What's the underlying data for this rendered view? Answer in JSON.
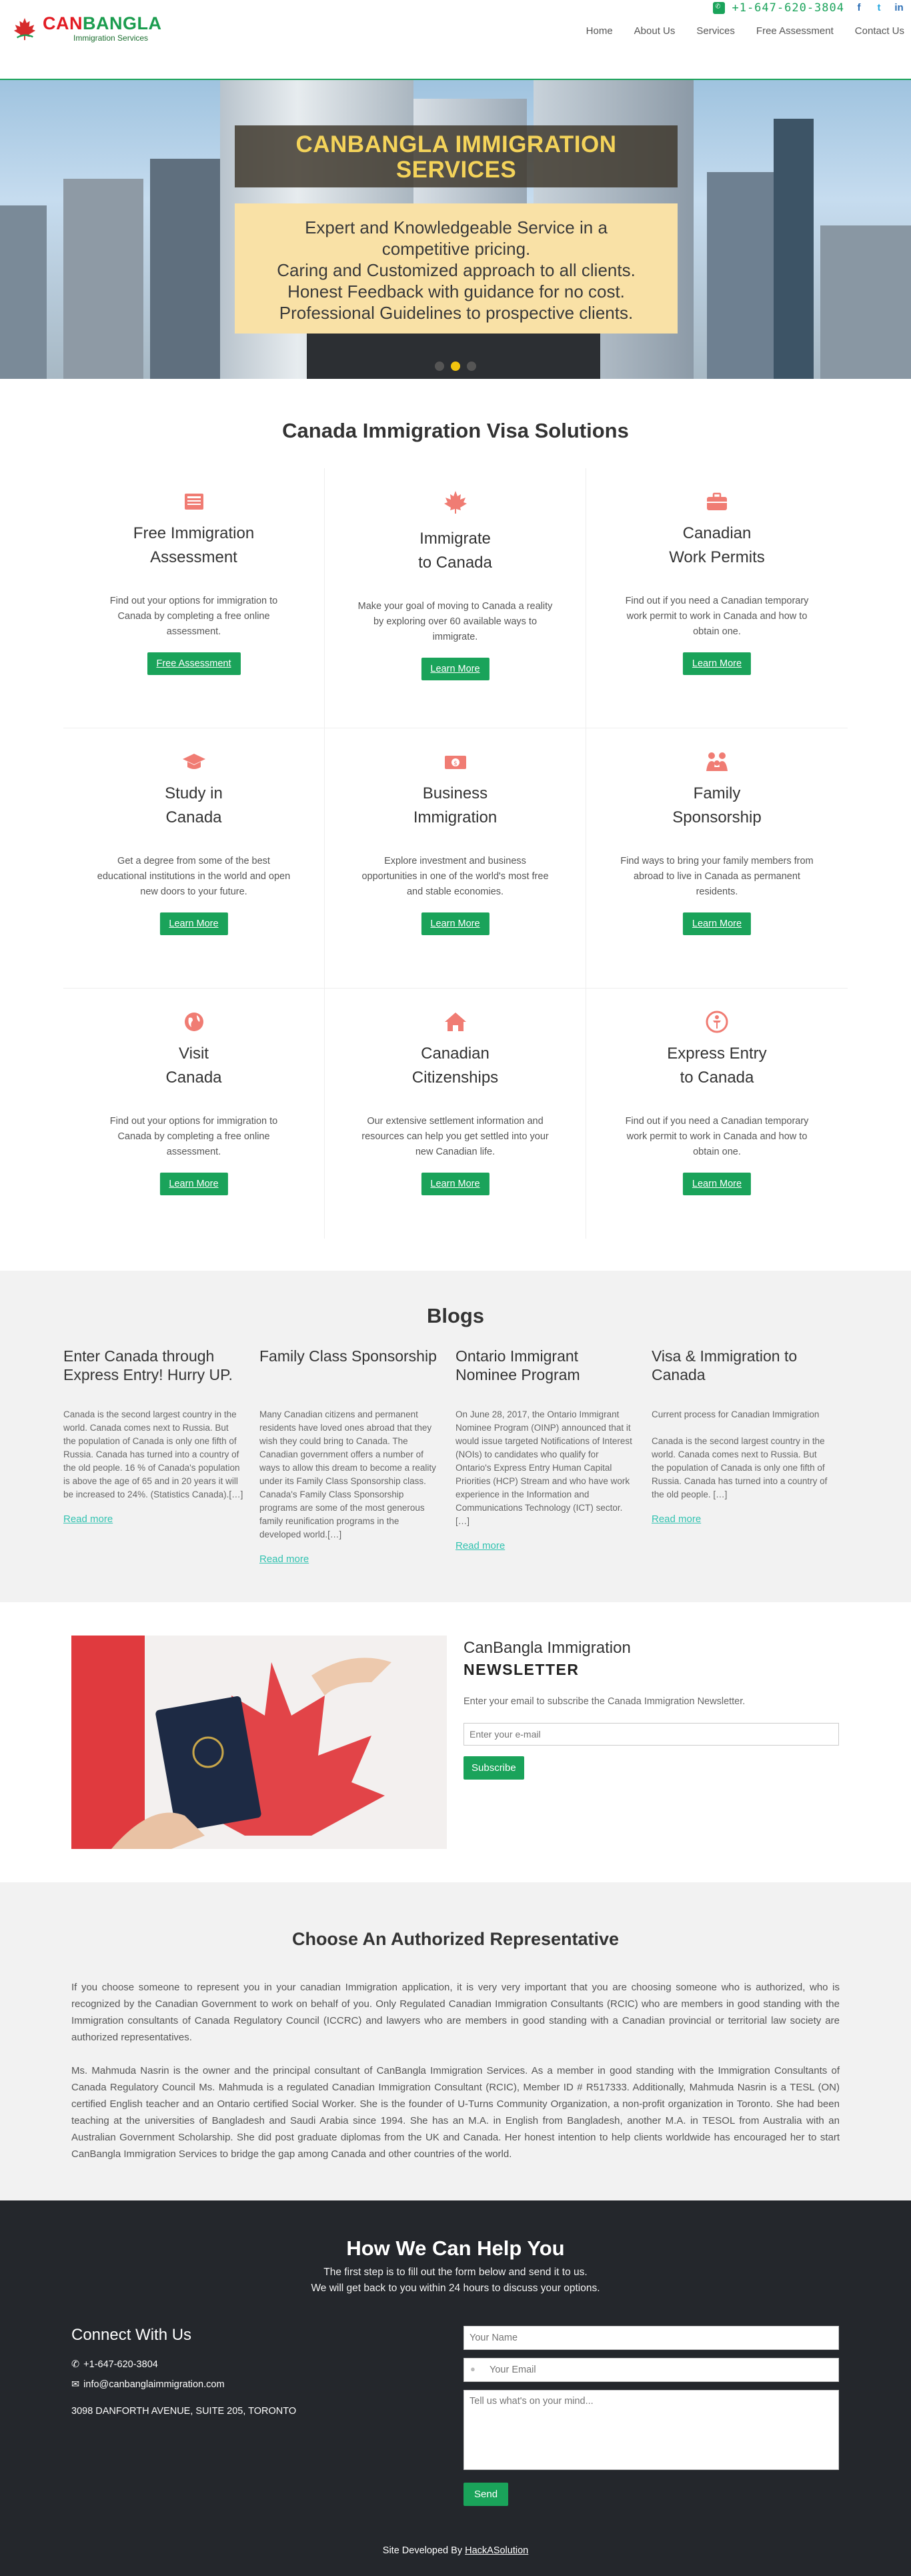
{
  "header": {
    "brand_part1": "CAN",
    "brand_part2": "BANGLA",
    "brand_sub": "Immigration Services",
    "phone": "+1-647-620-3804",
    "nav": [
      "Home",
      "About Us",
      "Services",
      "Free Assessment",
      "Contact Us"
    ],
    "social_icons": [
      "facebook-icon",
      "twitter-icon",
      "linkedin-icon"
    ]
  },
  "hero": {
    "title_line1": "CANBANGLA IMMIGRATION",
    "title_line2": "SERVICES",
    "lines": [
      "Expert and Knowledgeable Service in a",
      "competitive pricing.",
      "Caring and Customized approach to all clients.",
      "Honest Feedback with guidance for no cost.",
      "Professional Guidelines to prospective clients."
    ]
  },
  "visa": {
    "title": "Canada Immigration Visa Solutions",
    "cards": [
      {
        "icon": "calculator-icon",
        "title1": "Free Immigration",
        "title2": "Assessment",
        "desc": "Find out your options for immigration to Canada by completing a free online assessment.",
        "button": "Free Assessment"
      },
      {
        "icon": "maple-leaf-icon",
        "title1": "Immigrate",
        "title2": "to Canada",
        "desc": "Make your goal of moving to Canada a reality by exploring over 60 available ways to immigrate.",
        "button": "Learn More"
      },
      {
        "icon": "briefcase-icon",
        "title1": "Canadian",
        "title2": "Work Permits",
        "desc": "Find out if you need a Canadian temporary work permit to work in Canada and how to obtain one.",
        "button": "Learn More"
      },
      {
        "icon": "graduation-cap-icon",
        "title1": "Study in",
        "title2": "Canada",
        "desc": "Get a degree from some of the best educational institutions in the world and open new doors to your future.",
        "button": "Learn More"
      },
      {
        "icon": "money-icon",
        "title1": "Business",
        "title2": "Immigration",
        "desc": "Explore investment and business opportunities in one of the world's most free and stable economies.",
        "button": "Learn More"
      },
      {
        "icon": "family-icon",
        "title1": "Family",
        "title2": "Sponsorship",
        "desc": "Find ways to bring your family members from abroad to live in Canada as permanent residents.",
        "button": "Learn More"
      },
      {
        "icon": "globe-icon",
        "title1": "Visit",
        "title2": "Canada",
        "desc": "Find out your options for immigration to Canada by completing a free online assessment.",
        "button": "Learn More"
      },
      {
        "icon": "home-icon",
        "title1": "Canadian",
        "title2": "Citizenships",
        "desc": "Our extensive settlement information and resources can help you get settled into your new Canadian life.",
        "button": "Learn More"
      },
      {
        "icon": "compass-icon",
        "title1": "Express Entry",
        "title2": "to Canada",
        "desc": "Find out if you need a Canadian temporary work permit to work in Canada and how to obtain one.",
        "button": "Learn More"
      }
    ]
  },
  "blogs": {
    "title": "Blogs",
    "read_more": "Read more",
    "items": [
      {
        "title": "Enter Canada through Express Entry! Hurry UP.",
        "text": "Canada is the second largest country in the world. Canada comes next to Russia. But the population of Canada is only one fifth of Russia. Canada has turned into a country of the old people. 16 % of Canada's population is above the age of 65 and in 20 years it will be increased to 24%. (Statistics Canada).[…]"
      },
      {
        "title": "Family Class Sponsorship",
        "text": "Many Canadian citizens and permanent residents have loved ones abroad that they wish they could bring to Canada. The Canadian government offers a number of ways to allow this dream to become a reality under its Family Class Sponsorship class. Canada's Family Class Sponsorship programs are some of the most generous family reunification programs in the developed world.[…]"
      },
      {
        "title": "Ontario Immigrant Nominee Program",
        "text": "On June 28, 2017, the Ontario Immigrant Nominee Program (OINP) announced that it would issue targeted Notifications of Interest (NOIs) to candidates who qualify for Ontario's Express Entry Human Capital Priorities (HCP) Stream and who have work experience in the Information and Communications Technology (ICT) sector. […]"
      },
      {
        "title": "Visa & Immigration to Canada",
        "text_intro": "Current process for Canadian Immigration",
        "text": "Canada is the second largest country in the world. Canada comes next to Russia. But the population of Canada is only one fifth of Russia. Canada has turned into a country of the old people. […]"
      }
    ]
  },
  "newsletter": {
    "brand": "CanBangla Immigration",
    "title": "NEWSLETTER",
    "desc": "Enter your email to subscribe the Canada Immigration Newsletter.",
    "placeholder": "Enter your e-mail",
    "button": "Subscribe"
  },
  "representative": {
    "title": "Choose An Authorized Representative",
    "p1": "If you choose someone to represent you in your canadian Immigration application, it is very very important that you are choosing someone who is authorized, who is recognized by the Canadian Government to work on behalf of you. Only Regulated Canadian Immigration Consultants (RCIC) who are members in good standing with the Immigration consultants of Canada Regulatory Council (ICCRC) and lawyers who are members in good standing with a Canadian provincial or territorial law society are authorized representatives.",
    "p2": "Ms. Mahmuda Nasrin is the owner and the principal consultant of CanBangla Immigration Services. As a member in good standing with the Immigration Consultants of Canada Regulatory Council Ms. Mahmuda is a regulated Canadian Immigration Consultant (RCIC), Member ID # R517333. Additionally, Mahmuda Nasrin is a TESL (ON) certified English teacher and an Ontario certified Social Worker. She is the founder of U-Turns Community Organization, a non-profit organization in Toronto. She had been teaching at the universities of Bangladesh and Saudi Arabia since 1994. She has an M.A. in English from Bangladesh, another M.A. in TESOL from Australia with an Australian Government Scholarship. She did post graduate diplomas from the UK and Canada. Her honest intention to help clients worldwide has encouraged her to start CanBangla Immigration Services to bridge the gap among Canada and other countries of the world."
  },
  "help": {
    "title": "How We Can Help You",
    "sub1": "The first step is to fill out the form below and send it to us.",
    "sub2": "We will get back to you within 24 hours to discuss your options.",
    "connect_title": "Connect With Us",
    "phone": "+1-647-620-3804",
    "email": "info@canbanglaimmigration.com",
    "address": "3098 DANFORTH AVENUE, SUITE 205, TORONTO",
    "name_placeholder": "Your Name",
    "email_placeholder": "Your Email",
    "message_placeholder": "Tell us what's on your mind...",
    "send": "Send",
    "credit_prefix": "Site Developed By",
    "credit_link": "HackASolution"
  },
  "colors": {
    "green": "#1aa35a",
    "red": "#e21b23",
    "coral": "#f07c73",
    "dark": "#24272c"
  }
}
